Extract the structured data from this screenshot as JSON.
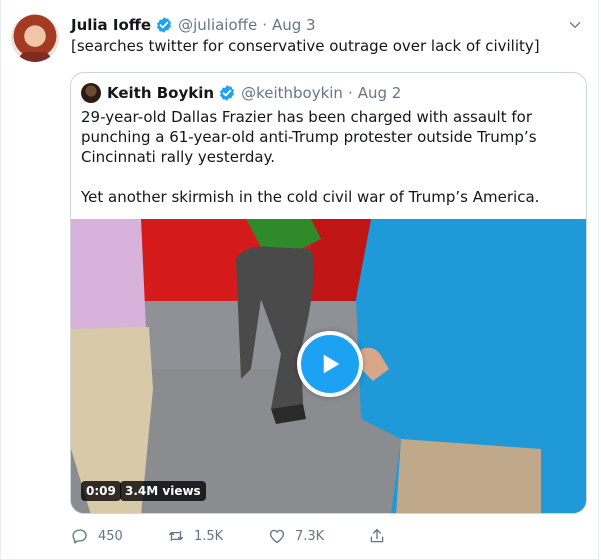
{
  "tweet": {
    "author_name": "Julia Ioffe",
    "author_handle": "@juliaioffe",
    "separator": "·",
    "date": "Aug 3",
    "text": "[searches twitter for conservative outrage over lack of civility]"
  },
  "quoted_tweet": {
    "author_name": "Keith Boykin",
    "author_handle": "@keithboykin",
    "separator": "·",
    "date": "Aug 2",
    "paragraph_1": "29-year-old Dallas Frazier has been charged with assault for punching a 61-year-old anti-Trump protester outside Trump’s Cincinnati rally yesterday.",
    "paragraph_2": "Yet another skirmish in the cold civil war of Trump’s America.",
    "video": {
      "duration": "0:09",
      "views": "3.4M views"
    }
  },
  "actions": {
    "reply_count": "450",
    "retweet_count": "1.5K",
    "like_count": "7.3K"
  },
  "icons": {
    "verified": "verified-badge-icon",
    "caret": "chevron-down-icon",
    "play": "play-icon",
    "reply": "reply-icon",
    "retweet": "retweet-icon",
    "like": "heart-icon",
    "share": "share-icon"
  },
  "colors": {
    "accent": "#1da1f2",
    "text_primary": "#14171a",
    "text_secondary": "#657786",
    "border": "#e6ecf0"
  }
}
